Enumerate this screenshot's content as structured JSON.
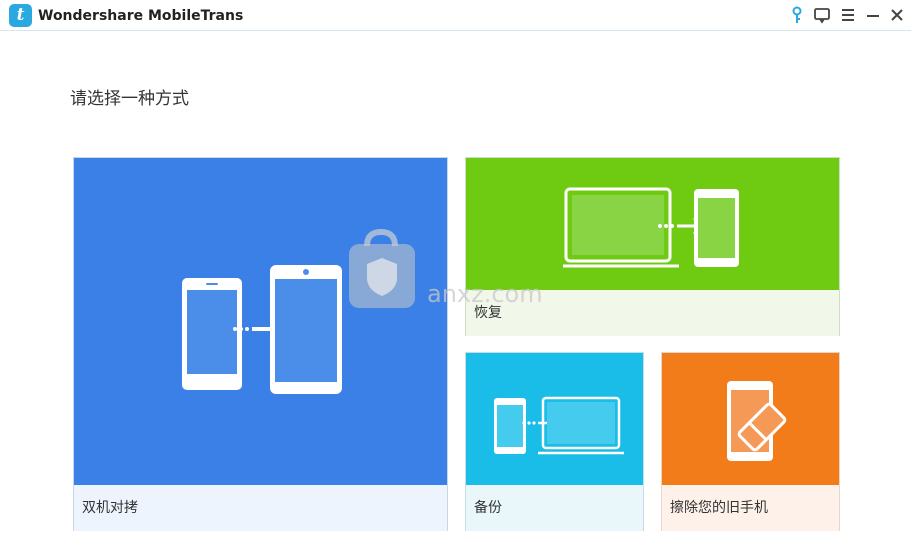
{
  "titlebar": {
    "logo_letter": "t",
    "app_title": "Wondershare MobileTrans"
  },
  "heading": "请选择一种方式",
  "tiles": {
    "phone_transfer": {
      "label": "双机对拷",
      "color": "#3a80e6"
    },
    "restore": {
      "label": "恢复",
      "color": "#6fcb12"
    },
    "backup": {
      "label": "备份",
      "color": "#19bde7"
    },
    "erase": {
      "label": "擦除您的旧手机",
      "color": "#f27b1a"
    }
  },
  "watermark": {
    "text": "anxz.com"
  }
}
